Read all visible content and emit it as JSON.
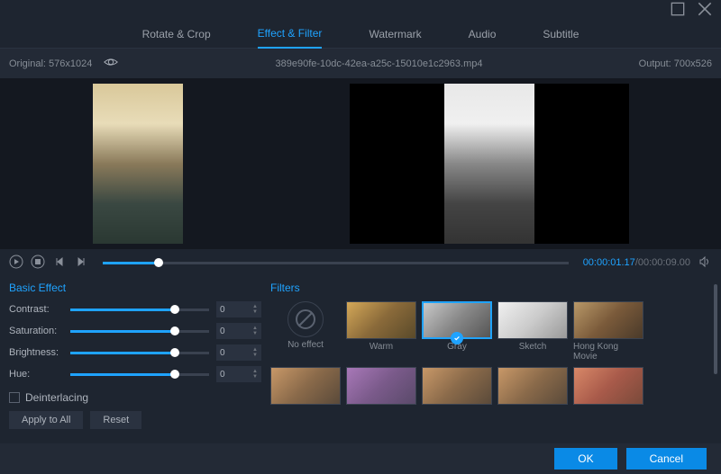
{
  "tabs": [
    "Rotate & Crop",
    "Effect & Filter",
    "Watermark",
    "Audio",
    "Subtitle"
  ],
  "activeTab": 1,
  "info": {
    "original": "Original: 576x1024",
    "filename": "389e90fe-10dc-42ea-a25c-15010e1c2963.mp4",
    "output": "Output: 700x526"
  },
  "time": {
    "current": "00:00:01.17",
    "total": "00:00:09.00"
  },
  "basicEffect": {
    "title": "Basic Effect",
    "rows": [
      {
        "label": "Contrast:",
        "value": "0"
      },
      {
        "label": "Saturation:",
        "value": "0"
      },
      {
        "label": "Brightness:",
        "value": "0"
      },
      {
        "label": "Hue:",
        "value": "0"
      }
    ],
    "deinterlacing": "Deinterlacing",
    "applyAll": "Apply to All",
    "reset": "Reset"
  },
  "filters": {
    "title": "Filters",
    "items": [
      {
        "label": "No effect",
        "style": "noeffect"
      },
      {
        "label": "Warm",
        "style": "thumb-warm"
      },
      {
        "label": "Gray",
        "style": "thumb-gray",
        "selected": true
      },
      {
        "label": "Sketch",
        "style": "thumb-sketch"
      },
      {
        "label": "Hong Kong Movie",
        "style": "thumb-hk"
      },
      {
        "label": "",
        "style": "thumb-generic"
      },
      {
        "label": "",
        "style": "thumb-purple"
      },
      {
        "label": "",
        "style": "thumb-generic"
      },
      {
        "label": "",
        "style": "thumb-generic"
      },
      {
        "label": "",
        "style": "thumb-red"
      }
    ]
  },
  "footer": {
    "ok": "OK",
    "cancel": "Cancel"
  }
}
